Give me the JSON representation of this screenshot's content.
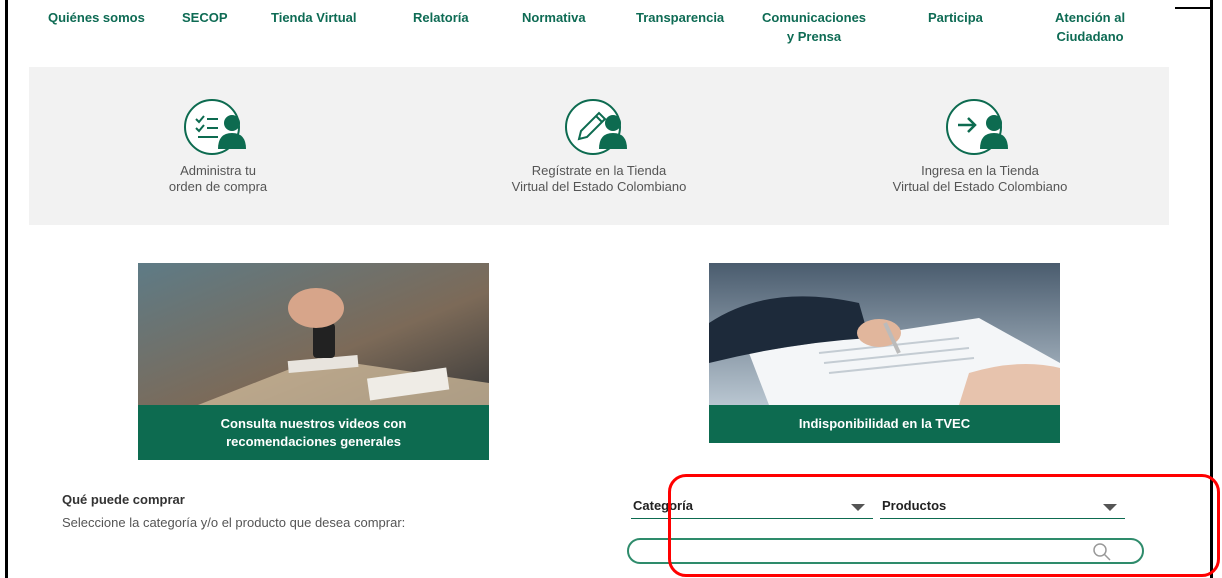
{
  "nav": [
    {
      "line1": "Quiénes somos",
      "line2": ""
    },
    {
      "line1": "SECOP",
      "line2": ""
    },
    {
      "line1": "Tienda Virtual",
      "line2": ""
    },
    {
      "line1": "Relatoría",
      "line2": ""
    },
    {
      "line1": "Normativa",
      "line2": ""
    },
    {
      "line1": "Transparencia",
      "line2": ""
    },
    {
      "line1": "Comunicaciones",
      "line2": "y Prensa"
    },
    {
      "line1": "Participa",
      "line2": ""
    },
    {
      "line1": "Atención al",
      "line2": "Ciudadano"
    }
  ],
  "quick_access": [
    {
      "icon": "checklist-user-icon",
      "line1": "Administra tu",
      "line2": "orden de compra"
    },
    {
      "icon": "edit-user-icon",
      "line1": "Regístrate en la Tienda",
      "line2": "Virtual del Estado Colombiano"
    },
    {
      "icon": "login-user-icon",
      "line1": "Ingresa en la Tienda",
      "line2": "Virtual del Estado Colombiano"
    }
  ],
  "cards": [
    {
      "line1": "Consulta nuestros videos con",
      "line2": "recomendaciones generales"
    },
    {
      "line1": "Indisponibilidad en la TVEC",
      "line2": ""
    }
  ],
  "buy": {
    "title": "Qué puede comprar",
    "subtitle": "Seleccione la categoría y/o el producto que desea comprar:",
    "category_label": "Categoría",
    "products_label": "Productos",
    "search_placeholder": ""
  },
  "colors": {
    "brand": "#0d6b50",
    "highlight": "#ff0000"
  }
}
